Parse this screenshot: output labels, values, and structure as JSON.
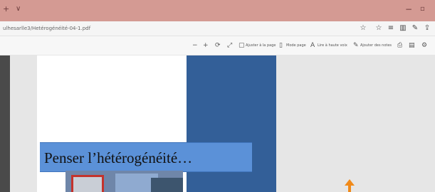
{
  "browser": {
    "tab_add_glyph": "+",
    "tab_menu_glyph": "∨",
    "minimize_glyph": "−",
    "maximize_glyph": "▫",
    "url": "ulhesarlle3/Hetérogénéité-04-1.pdf"
  },
  "address_icons": [
    "favorite-icon",
    "favorites-list-icon",
    "hub-icon",
    "reading-icon",
    "notes-icon",
    "share-icon"
  ],
  "pdf_toolbar": {
    "zoom_out": "−",
    "zoom_in": "+",
    "rotate": "⟳",
    "fullscreen": "⤢",
    "fit_page": "Ajuster à la page",
    "page_view": "Mode page",
    "read_aloud": "Lire à haute voix",
    "add_notes": "Ajouter des notes"
  },
  "document": {
    "banner_title": "Penser l’hétérogénéité…"
  },
  "colors": {
    "titlebar": "#d49a93",
    "page_blue": "#335f98",
    "banner_blue": "#5b91d8",
    "cursor": "#f08a1a"
  }
}
